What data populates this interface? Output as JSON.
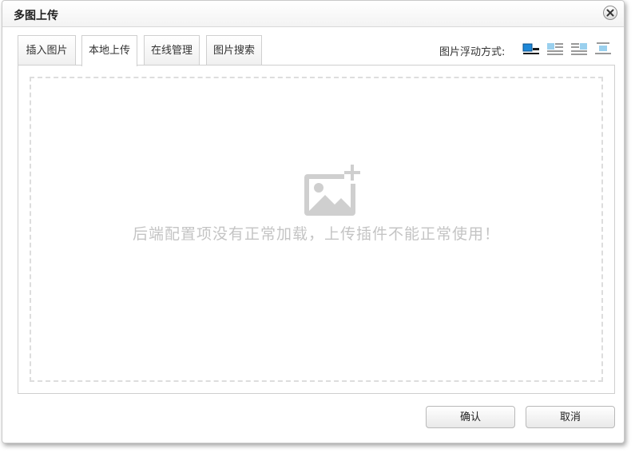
{
  "dialog": {
    "title": "多图上传",
    "close_icon": "close-icon"
  },
  "tabs": [
    {
      "label": "插入图片",
      "active": false
    },
    {
      "label": "本地上传",
      "active": true
    },
    {
      "label": "在线管理",
      "active": false
    },
    {
      "label": "图片搜索",
      "active": false
    }
  ],
  "float": {
    "label": "图片浮动方式:",
    "options": [
      "float-none-icon",
      "float-left-icon",
      "float-right-icon",
      "float-center-icon"
    ],
    "selected_index": 0
  },
  "upload": {
    "message": "后端配置项没有正常加载，上传插件不能正常使用！",
    "icon": "add-image-icon"
  },
  "buttons": {
    "confirm": "确认",
    "cancel": "取消"
  },
  "colors": {
    "accent": "#1e88d8",
    "muted_icon": "#cfcfcf",
    "message_text": "#c4c4c4"
  }
}
